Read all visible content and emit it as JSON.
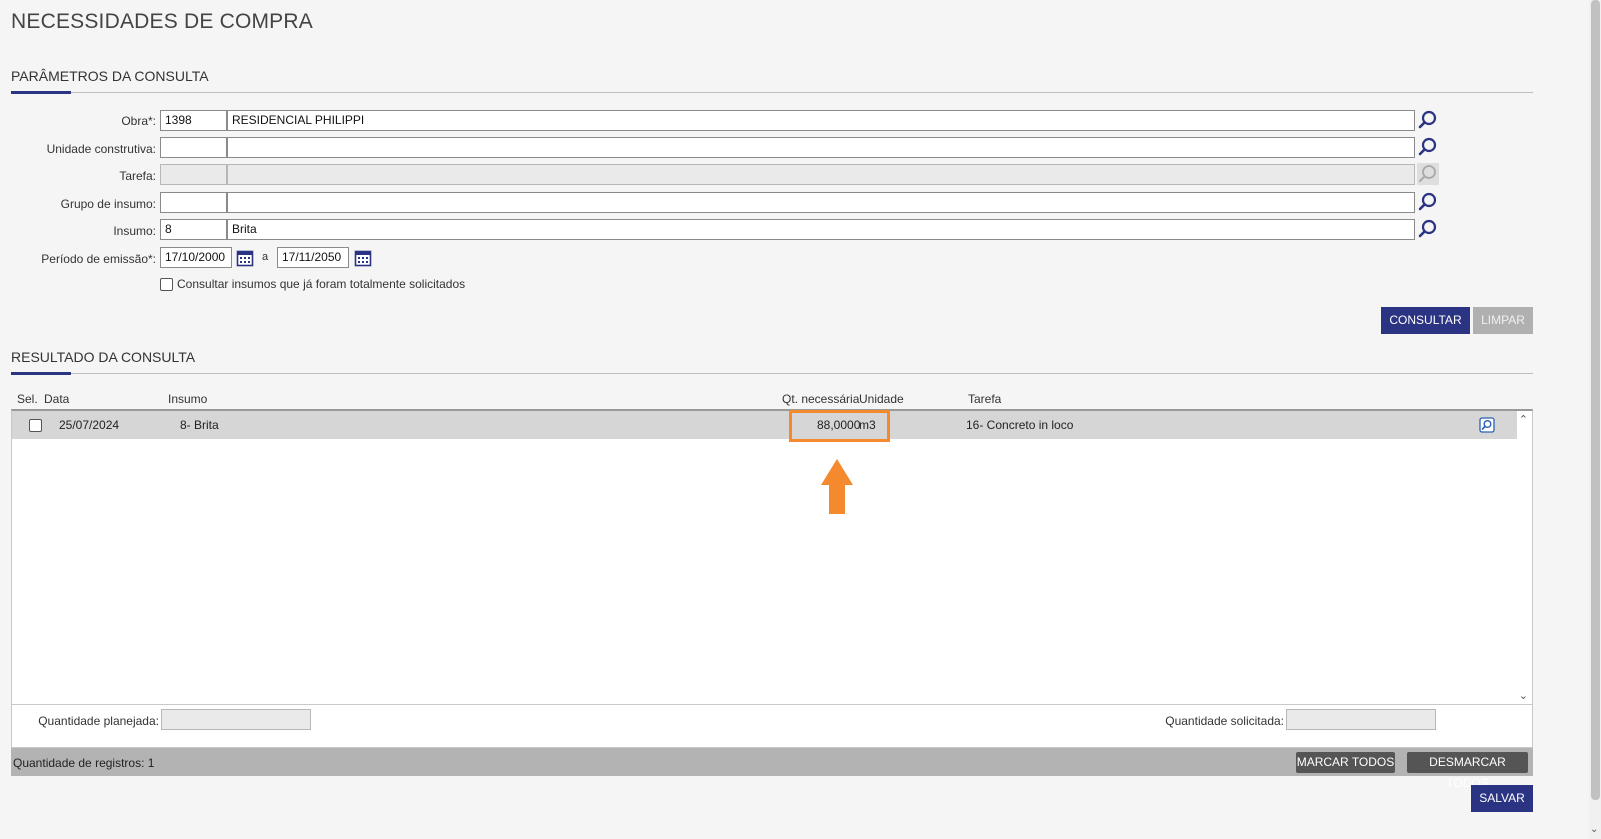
{
  "page": {
    "title": "NECESSIDADES DE COMPRA"
  },
  "params": {
    "title": "PARÂMETROS DA CONSULTA",
    "obra": {
      "label": "Obra*:",
      "code": "1398",
      "name": "RESIDENCIAL PHILIPPI"
    },
    "unidade": {
      "label": "Unidade construtiva:",
      "code": "",
      "name": ""
    },
    "tarefa": {
      "label": "Tarefa:",
      "code": "",
      "name": ""
    },
    "grupo": {
      "label": "Grupo de insumo:",
      "code": "",
      "name": ""
    },
    "insumo": {
      "label": "Insumo:",
      "code": "8",
      "name": "Brita"
    },
    "periodo": {
      "label": "Período de emissão*:",
      "from": "17/10/2000",
      "sep": "a",
      "to": "17/11/2050"
    },
    "checkbox_label": "Consultar insumos que já foram totalmente solicitados",
    "consultar": "CONSULTAR",
    "limpar": "LIMPAR"
  },
  "result": {
    "title": "RESULTADO DA CONSULTA",
    "columns": {
      "sel": "Sel.",
      "data": "Data",
      "insumo": "Insumo",
      "qt": "Qt. necessária",
      "unidade": "Unidade",
      "tarefa": "Tarefa"
    },
    "rows": [
      {
        "data": "25/07/2024",
        "insumo": "8- Brita",
        "qt": "88,0000",
        "unidade": "m3",
        "tarefa": "16- Concreto in loco"
      }
    ],
    "qtd_planejada_label": "Quantidade planejada:",
    "qtd_planejada": "",
    "qtd_solicitada_label": "Quantidade solicitada:",
    "qtd_solicitada": "",
    "registros": "Quantidade de registros: 1",
    "marcar_todos": "MARCAR TODOS",
    "desmarcar_todos": "DESMARCAR TODOS",
    "salvar": "SALVAR"
  },
  "colors": {
    "primary": "#2b3383",
    "highlight": "#f5892e"
  }
}
